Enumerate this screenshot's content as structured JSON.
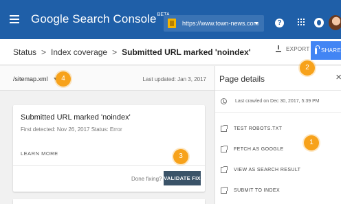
{
  "appbar": {
    "title": "Google Search Console",
    "title_badge": "BETA",
    "property_url": "https://www.town-news.com"
  },
  "breadcrumb": {
    "items": [
      "Status",
      "Index coverage",
      "Submitted URL marked 'noindex'"
    ],
    "separator": ">"
  },
  "toolbar": {
    "export_label": "EXPORT",
    "share_label": "SHARE"
  },
  "sitemap_bar": {
    "selected": "/sitemap.xml",
    "last_updated": "Last updated: Jan 3, 2017"
  },
  "issue_card": {
    "title": "Submitted URL marked 'noindex'",
    "meta": "First detected: Nov 26, 2017   Status: Error",
    "learn_more": "LEARN MORE",
    "done_fixing": "Done fixing?",
    "validate_label": "VALIDATE FIX"
  },
  "page_details": {
    "title": "Page details",
    "close": "×",
    "last_crawled": "Last crawled on Dec 30, 2017, 5:39 PM",
    "actions": [
      "TEST ROBOTS.TXT",
      "FETCH AS GOOGLE",
      "VIEW AS SEARCH RESULT",
      "SUBMIT TO INDEX"
    ]
  },
  "markers": [
    "1",
    "2",
    "3",
    "4"
  ],
  "colors": {
    "appbar": "#1f5fa8",
    "share": "#4285f4",
    "validate": "#3a5368",
    "marker": "#f7a21b"
  }
}
